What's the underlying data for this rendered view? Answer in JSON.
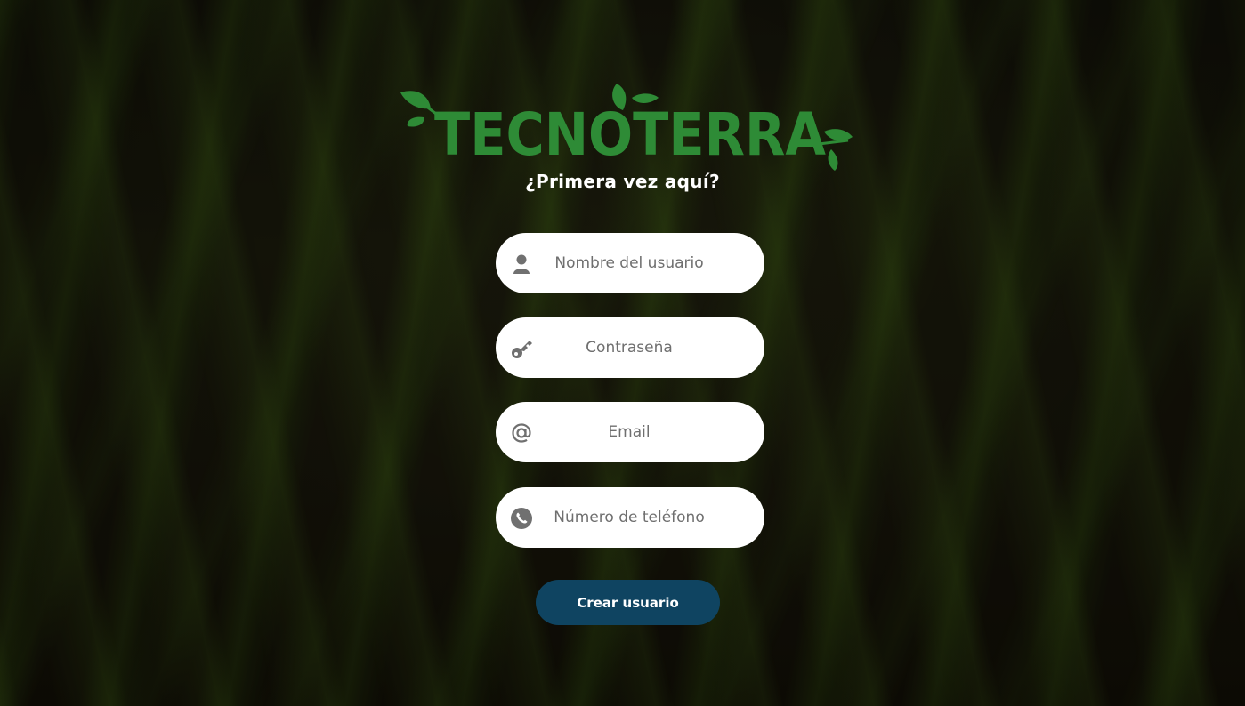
{
  "brand": {
    "logo_text": "TECNOTERRA",
    "logo_color": "#2e8b36"
  },
  "form": {
    "heading": "¿Primera vez aquí?",
    "fields": [
      {
        "placeholder": "Nombre del usuario",
        "icon": "user-icon"
      },
      {
        "placeholder": "Contraseña",
        "icon": "key-icon"
      },
      {
        "placeholder": "Email",
        "icon": "at-sign-icon"
      },
      {
        "placeholder": "Número de teléfono",
        "icon": "phone-icon"
      }
    ],
    "submit_label": "Crear usuario"
  },
  "colors": {
    "button": "#0f4461",
    "field_bg": "#ffffff",
    "icon": "#707070"
  }
}
